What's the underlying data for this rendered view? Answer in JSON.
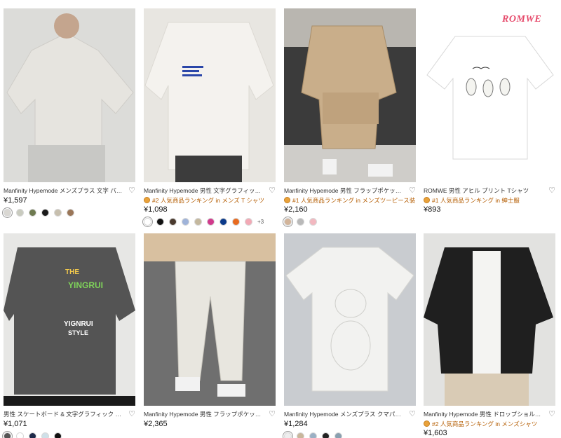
{
  "products": [
    {
      "title": "Manfinity Hypemode メンズプラス 文字 パッチ付き デ...",
      "badge": "",
      "price": "¥1,597",
      "swatches": [
        "#d9d7d2",
        "#c9cbbf",
        "#6e7a50",
        "#1b1b1b",
        "#c7bfae",
        "#9a7658"
      ],
      "more": ""
    },
    {
      "title": "Manfinity Hypemode 男性 文字グラフィック ドロップ...",
      "badge": "#2 人気商品ランキング in メンズ T シャツ",
      "price": "¥1,098",
      "swatches": [
        "#ffffff",
        "#111111",
        "#4a3a2e",
        "#9fb3d9",
        "#c4b89e",
        "#d13a8c",
        "#0b3a8a",
        "#e86a1f",
        "#f2a9b5"
      ],
      "more": "+3"
    },
    {
      "title": "Manfinity Hypemode 男性 フラップポケット シャツ & ...",
      "badge": "#1 人気商品ランキング in メンズツーピース装",
      "price": "¥2,160",
      "swatches": [
        "#d2b49a",
        "#b9b9b9",
        "#f2b8c0"
      ],
      "more": ""
    },
    {
      "title": "ROMWE 男性 アヒル プリント Tシャツ",
      "badge": "#1 人気商品ランキング in 紳士服",
      "price": "¥893",
      "swatches": [],
      "more": ""
    },
    {
      "title": "男性 スケートボード & 文字グラフィック ドロップショ...",
      "badge": "",
      "price": "¥1,071",
      "swatches": [
        "#555555",
        "#ffffff",
        "#1d2a4a",
        "#cfe0e8",
        "#111111"
      ],
      "more": ""
    },
    {
      "title": "Manfinity Hypemode 男性 フラップポケットサイド ド...",
      "badge": "",
      "price": "¥2,365",
      "swatches": [],
      "more": ""
    },
    {
      "title": "Manfinity Hypemode メンズプラス クマパターン Tシャツ",
      "badge": "",
      "price": "¥1,284",
      "swatches": [
        "#eeeeee",
        "#c9b79c",
        "#9bb0c4",
        "#222222",
        "#8aa0b0"
      ],
      "more": ""
    },
    {
      "title": "Manfinity Hypemode 男性 ドロップショルダー サイド...",
      "badge": "#2 人気商品ランキング in メンズシャツ",
      "price": "¥1,603",
      "swatches": [],
      "more": ""
    }
  ],
  "brand_logo": "ROMWE",
  "icons": {
    "heart": "heart-icon",
    "medal": "medal-icon"
  },
  "colors": {
    "badge_text": "#b45c00",
    "medal": "#e9a23b"
  }
}
